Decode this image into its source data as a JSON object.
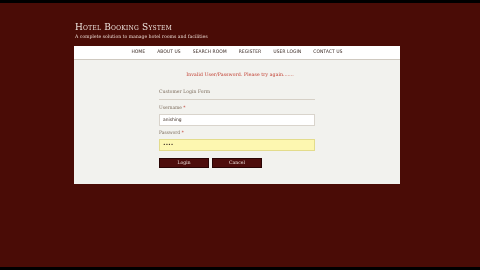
{
  "header": {
    "title": "Hotel Booking System",
    "tagline": "A complete solution to manage hotel rooms and facilities"
  },
  "nav": {
    "items": [
      "HOME",
      "ABOUT US",
      "SEARCH ROOM",
      "REGISTER",
      "USER LOGIN",
      "CONTACT US"
    ]
  },
  "login": {
    "error": "Invalid User/Password. Please try again.......",
    "form_title": "Customer Login Form",
    "username_label": "Username",
    "password_label": "Password",
    "required_mark": "*",
    "username_value": "anishing",
    "password_value": "••••",
    "login_button": "Login",
    "cancel_button": "Cancel"
  },
  "colors": {
    "background": "#4a0c06",
    "button": "#4e0e0c",
    "error": "#c0392b",
    "password_fill": "#fdf7b0"
  }
}
